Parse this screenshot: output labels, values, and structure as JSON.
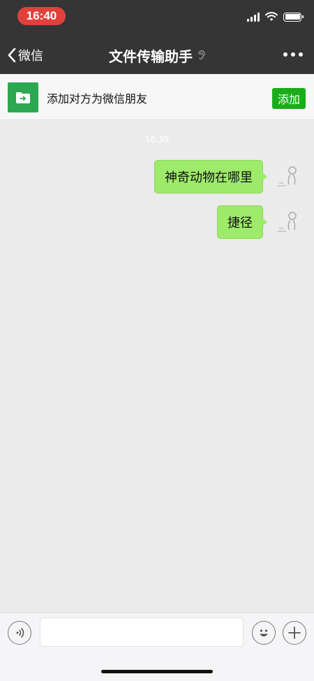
{
  "status_bar": {
    "time": "16:40"
  },
  "nav": {
    "back_label": "微信",
    "title": "文件传输助手"
  },
  "banner": {
    "text": "添加对方为微信朋友",
    "add_label": "添加"
  },
  "chat": {
    "timestamp": "16:39",
    "messages": [
      {
        "text": "神奇动物在哪里"
      },
      {
        "text": "捷径"
      }
    ]
  },
  "input": {
    "value": "",
    "placeholder": ""
  },
  "colors": {
    "header_bg": "#353535",
    "bubble": "#9eea6a",
    "accent_green": "#1aad19",
    "time_pill": "#e0413b"
  }
}
